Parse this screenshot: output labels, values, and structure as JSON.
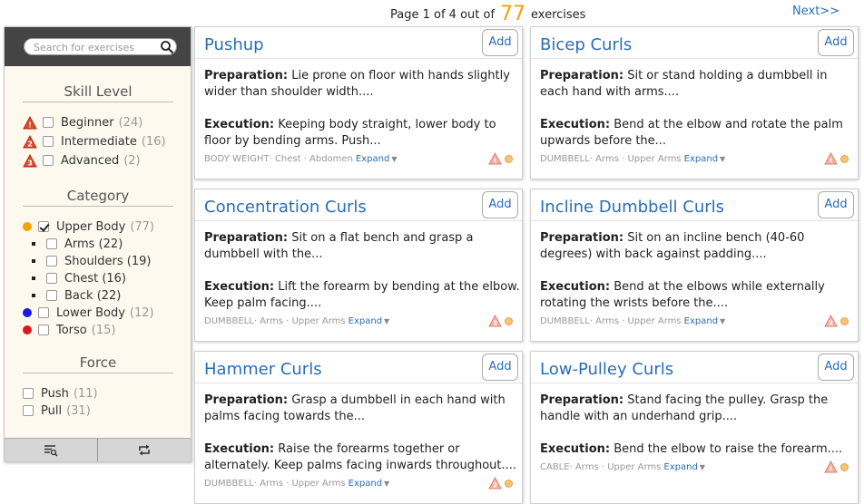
{
  "pagination": {
    "prefix": "Page 1 of 4 out of",
    "total": "77",
    "suffix": "exercises",
    "next_label": "Next>>"
  },
  "search": {
    "placeholder": "Search for exercises",
    "value": ""
  },
  "skill_level": {
    "heading": "Skill Level",
    "items": [
      {
        "label": "Beginner",
        "count": "(24)",
        "icon": "warning-1-icon",
        "checked": false
      },
      {
        "label": "Intermediate",
        "count": "(16)",
        "icon": "warning-2-icon",
        "checked": false
      },
      {
        "label": "Advanced",
        "count": "(2)",
        "icon": "warning-3-icon",
        "checked": false
      }
    ]
  },
  "category": {
    "heading": "Category",
    "items": [
      {
        "label": "Upper Body",
        "count": "(77)",
        "dot_color": "#f0a30a",
        "checked": true
      },
      {
        "label": "Arms (22)",
        "sub": true
      },
      {
        "label": "Shoulders (19)",
        "sub": true
      },
      {
        "label": "Chest (16)",
        "sub": true
      },
      {
        "label": "Back (22)",
        "sub": true
      },
      {
        "label": "Lower Body",
        "count": "(12)",
        "dot_color": "#1a1ae0",
        "checked": false
      },
      {
        "label": "Torso",
        "count": "(15)",
        "dot_color": "#d81a1a",
        "checked": false
      }
    ]
  },
  "force": {
    "heading": "Force",
    "items": [
      {
        "label": "Push",
        "count": "(11)"
      },
      {
        "label": "Pull",
        "count": "(31)"
      }
    ]
  },
  "footer_icons": [
    "list-search-icon",
    "repeat-icon"
  ],
  "colors": {
    "link": "#2a6db5",
    "accent": "#f0a30a",
    "sidebar_bg": "#fdf9ee",
    "search_bg": "#444444"
  },
  "add_label": "Add",
  "expand_label": "Expand",
  "prep_label": "Preparation:",
  "exec_label": "Execution:",
  "cards": [
    {
      "title": "Pushup",
      "prep": "Lie prone on floor with hands slightly wider than shoulder width....",
      "exec": "Keeping body straight, lower body to floor by bending arms. Push...",
      "meta": "BODY WEIGHT· Chest · Abdomen",
      "level_icon": "warning-1-icon"
    },
    {
      "title": "Bicep Curls",
      "prep": "Sit or stand holding a dumbbell in each hand with arms....",
      "exec": "Bend at the elbow and rotate the palm upwards before the...",
      "meta": "DUMBBELL· Arms · Upper Arms",
      "level_icon": "warning-1-icon"
    },
    {
      "title": "Concentration Curls",
      "prep": "Sit on a flat bench and grasp a dumbbell with the...",
      "exec": "Lift the forearm by bending at the elbow. Keep palm facing....",
      "meta": "DUMBBELL· Arms · Upper Arms",
      "level_icon": "warning-2-icon"
    },
    {
      "title": "Incline Dumbbell Curls",
      "prep": "Sit on an incline bench (40-60 degrees) with back against padding....",
      "exec": "Bend at the elbows while externally rotating the wrists before the....",
      "meta": "DUMBBELL· Arms · Upper Arms",
      "level_icon": "warning-2-icon"
    },
    {
      "title": "Hammer Curls",
      "prep": "Grasp a dumbbell in each hand with palms facing towards the...",
      "exec": "Raise the forearms together or alternately. Keep palms facing inwards throughout....",
      "meta": "DUMBBELL· Arms · Upper Arms",
      "level_icon": "warning-2-icon"
    },
    {
      "title": "Low-Pulley Curls",
      "prep": "Stand facing the pulley. Grasp the handle with an underhand grip....",
      "exec": "Bend the elbow to raise the forearm....",
      "meta": "CABLE· Arms · Upper Arms",
      "level_icon": "warning-1-icon"
    }
  ]
}
